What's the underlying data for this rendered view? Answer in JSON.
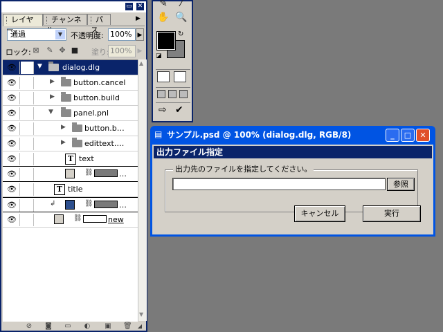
{
  "layers_panel": {
    "tabs": [
      {
        "label": "レイヤー"
      },
      {
        "label": "チャンネル"
      },
      {
        "label": "パス"
      }
    ],
    "blend_mode": "通過",
    "opacity_label": "不透明度:",
    "opacity_value": "100%",
    "lock_label": "ロック:",
    "fill_label": "塗り:",
    "fill_value": "100%",
    "layers": [
      {
        "name": "dialog.dlg",
        "kind": "group",
        "expanded": true,
        "selected": true
      },
      {
        "name": "button.cancel",
        "kind": "group",
        "expanded": false
      },
      {
        "name": "button.build",
        "kind": "group",
        "expanded": false
      },
      {
        "name": "panel.pnl",
        "kind": "group",
        "expanded": true
      },
      {
        "name": "button.b…",
        "kind": "group",
        "expanded": false
      },
      {
        "name": "edittext.…",
        "kind": "group",
        "expanded": false
      },
      {
        "name": "text",
        "kind": "text"
      },
      {
        "name": "…",
        "kind": "shape"
      },
      {
        "name": "title",
        "kind": "text"
      },
      {
        "name": "…",
        "kind": "shape-clipped"
      },
      {
        "name": "new",
        "kind": "shape-linked"
      }
    ]
  },
  "document": {
    "title": "サンプル.psd @ 100% (dialog.dlg, RGB/8)",
    "dialog": {
      "heading": "出力ファイル指定",
      "group_label": "出力先のファイルを指定してください。",
      "path_value": "",
      "browse_button": "参照",
      "cancel_button": "キャンセル",
      "run_button": "実行"
    }
  },
  "colors": {
    "selection": "#0a246a",
    "window_chrome": "#0054e3",
    "face": "#d4d0c8",
    "desktop": "#7a7a7a",
    "swatch_blue": "#2d4f8e"
  }
}
